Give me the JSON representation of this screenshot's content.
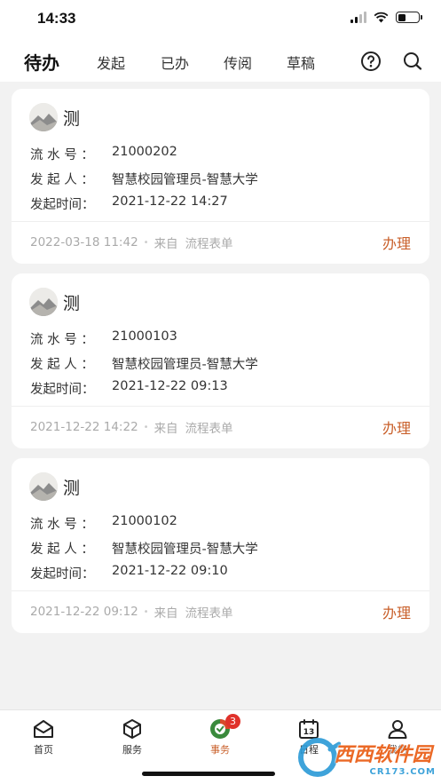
{
  "status_bar": {
    "time": "14:33"
  },
  "tabs": [
    {
      "label": "待办",
      "active": true
    },
    {
      "label": "发起",
      "active": false
    },
    {
      "label": "已办",
      "active": false
    },
    {
      "label": "传阅",
      "active": false
    },
    {
      "label": "草稿",
      "active": false
    }
  ],
  "header_icons": [
    "help-icon",
    "search-icon"
  ],
  "labels": {
    "serial": "流 水 号 ：",
    "initiator": "发 起 人 ：",
    "time": "发起时间："
  },
  "cards": [
    {
      "title": "测",
      "serial": "21000202",
      "initiator": "智慧校园管理员-智慧大学",
      "start_time": "2021-12-22 14:27",
      "updated": "2022-03-18 11:42",
      "source_prefix": "来自",
      "source": "流程表单",
      "action": "办理"
    },
    {
      "title": "测",
      "serial": "21000103",
      "initiator": "智慧校园管理员-智慧大学",
      "start_time": "2021-12-22 09:13",
      "updated": "2021-12-22 14:22",
      "source_prefix": "来自",
      "source": "流程表单",
      "action": "办理"
    },
    {
      "title": "测",
      "serial": "21000102",
      "initiator": "智慧校园管理员-智慧大学",
      "start_time": "2021-12-22 09:10",
      "updated": "2021-12-22 09:12",
      "source_prefix": "来自",
      "source": "流程表单",
      "action": "办理"
    }
  ],
  "bottom_nav": [
    {
      "label": "首页",
      "icon": "home-icon"
    },
    {
      "label": "服务",
      "icon": "cube-icon"
    },
    {
      "label": "事务",
      "icon": "affairs-icon",
      "badge": "3",
      "active": true
    },
    {
      "label": "日程",
      "icon": "calendar-icon",
      "calendar_day": "13"
    },
    {
      "label": "我的",
      "icon": "person-icon"
    }
  ],
  "watermark": {
    "text": "西西软件园",
    "url_text": "CR173.COM"
  },
  "colors": {
    "accent": "#c9602b",
    "badge": "#e0322b",
    "background": "#f2f2f2"
  }
}
